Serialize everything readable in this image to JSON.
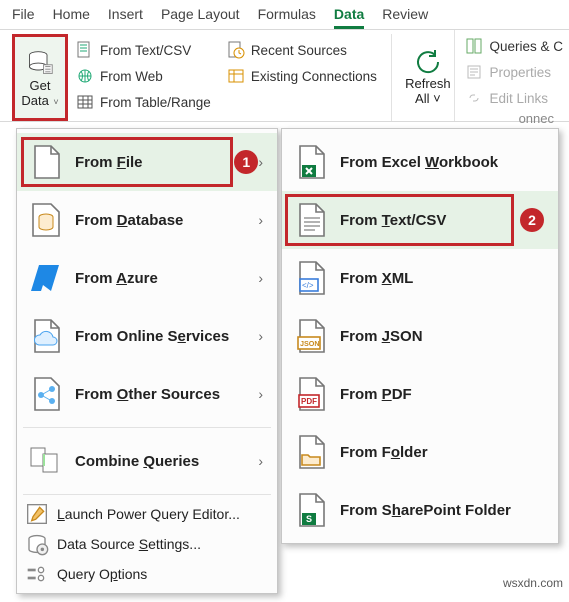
{
  "tabs": {
    "file": "File",
    "home": "Home",
    "insert": "Insert",
    "pagelayout": "Page Layout",
    "formulas": "Formulas",
    "data": "Data",
    "review": "Review"
  },
  "ribbon": {
    "get_data": "Get\nData",
    "from_text_csv": "From Text/CSV",
    "from_web": "From Web",
    "from_table_range": "From Table/Range",
    "recent_sources": "Recent Sources",
    "existing_connections": "Existing Connections",
    "refresh_all": "Refresh\nAll",
    "queries": "Queries & C",
    "properties": "Properties",
    "edit_links": "Edit Links"
  },
  "left_menu": {
    "from_file": "From File",
    "from_database": "From Database",
    "from_azure": "From Azure",
    "from_online": "From Online Services",
    "from_other": "From Other Sources",
    "combine": "Combine Queries",
    "launch_pq": "Launch Power Query Editor...",
    "ds_settings": "Data Source Settings...",
    "q_options": "Query Options"
  },
  "right_menu": {
    "excel_wb": "From Excel Workbook",
    "text_csv": "From Text/CSV",
    "xml": "From XML",
    "json": "From JSON",
    "pdf": "From PDF",
    "folder": "From Folder",
    "sp_folder": "From SharePoint Folder",
    "trail": "onnec"
  },
  "callouts": {
    "one": "1",
    "two": "2"
  },
  "watermark": "wsxdn.com"
}
